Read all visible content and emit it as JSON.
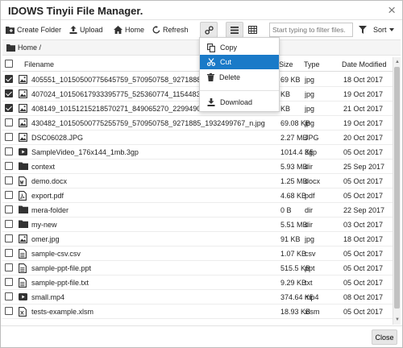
{
  "window": {
    "title": "IDOWS Tinyii File Manager.",
    "close_glyph": "×"
  },
  "toolbar": {
    "create_folder": "Create Folder",
    "upload": "Upload",
    "home": "Home",
    "refresh": "Refresh",
    "filter_placeholder": "Start typing to filter files.",
    "sort": "Sort"
  },
  "breadcrumb": {
    "label": "Home /"
  },
  "table": {
    "headers": {
      "filename": "Filename",
      "size": "Size",
      "type": "Type",
      "date": "Date Modified"
    },
    "rows": [
      {
        "name": "405551_10150500775645759_570950758_9271888_",
        "size": "69 KB",
        "type": "jpg",
        "date": "18 Oct 2017",
        "icon": "image-icon",
        "checked": true
      },
      {
        "name": "407024_10150617933395775_525360774_11544833",
        "size": "KB",
        "type": "jpg",
        "date": "19 Oct 2017",
        "icon": "image-icon",
        "checked": true
      },
      {
        "name": "408149_10151215218570271_849065270_22994904",
        "size": "KB",
        "type": "jpg",
        "date": "21 Oct 2017",
        "icon": "image-icon",
        "checked": true
      },
      {
        "name": "430482_10150500775255759_570950758_9271885_1932499767_n.jpg",
        "size": "69.08 KB",
        "type": "jpg",
        "date": "19 Oct 2017",
        "icon": "image-icon",
        "checked": false
      },
      {
        "name": "DSC06028.JPG",
        "size": "2.27 MB",
        "type": "JPG",
        "date": "20 Oct 2017",
        "icon": "image-icon",
        "checked": false
      },
      {
        "name": "SampleVideo_176x144_1mb.3gp",
        "size": "1014.4 KB",
        "type": "3gp",
        "date": "05 Oct 2017",
        "icon": "video-icon",
        "checked": false
      },
      {
        "name": "context",
        "size": "5.93 MB",
        "type": "dir",
        "date": "25 Sep 2017",
        "icon": "folder-icon",
        "checked": false
      },
      {
        "name": "demo.docx",
        "size": "1.25 MB",
        "type": "docx",
        "date": "05 Oct 2017",
        "icon": "word-file-icon",
        "checked": false
      },
      {
        "name": "export.pdf",
        "size": "4.68 KB",
        "type": "pdf",
        "date": "05 Oct 2017",
        "icon": "pdf-file-icon",
        "checked": false
      },
      {
        "name": "mera-folder",
        "size": "0 B",
        "type": "dir",
        "date": "22 Sep 2017",
        "icon": "folder-icon",
        "checked": false
      },
      {
        "name": "my-new",
        "size": "5.51 MB",
        "type": "dir",
        "date": "03 Oct 2017",
        "icon": "folder-icon",
        "checked": false
      },
      {
        "name": "omer.jpg",
        "size": "91 KB",
        "type": "jpg",
        "date": "18 Oct 2017",
        "icon": "image-icon",
        "checked": false
      },
      {
        "name": "sample-csv.csv",
        "size": "1.07 KB",
        "type": "csv",
        "date": "05 Oct 2017",
        "icon": "text-file-icon",
        "checked": false
      },
      {
        "name": "sample-ppt-file.ppt",
        "size": "515.5 KB",
        "type": "ppt",
        "date": "05 Oct 2017",
        "icon": "text-file-icon",
        "checked": false
      },
      {
        "name": "sample-ppt-file.txt",
        "size": "9.29 KB",
        "type": "txt",
        "date": "05 Oct 2017",
        "icon": "text-file-icon",
        "checked": false
      },
      {
        "name": "small.mp4",
        "size": "374.64 KB",
        "type": "mp4",
        "date": "08 Oct 2017",
        "icon": "video-icon",
        "checked": false
      },
      {
        "name": "tests-example.xlsm",
        "size": "18.93 KB",
        "type": "xlsm",
        "date": "05 Oct 2017",
        "icon": "excel-file-icon",
        "checked": false
      }
    ]
  },
  "context_menu": {
    "copy": "Copy",
    "cut": "Cut",
    "delete": "Delete",
    "download": "Download",
    "active_item": "cut"
  },
  "footer": {
    "close": "Close"
  },
  "colors": {
    "accent": "#1a7ac8",
    "scrollbar_thumb": "#c1c1c1"
  }
}
